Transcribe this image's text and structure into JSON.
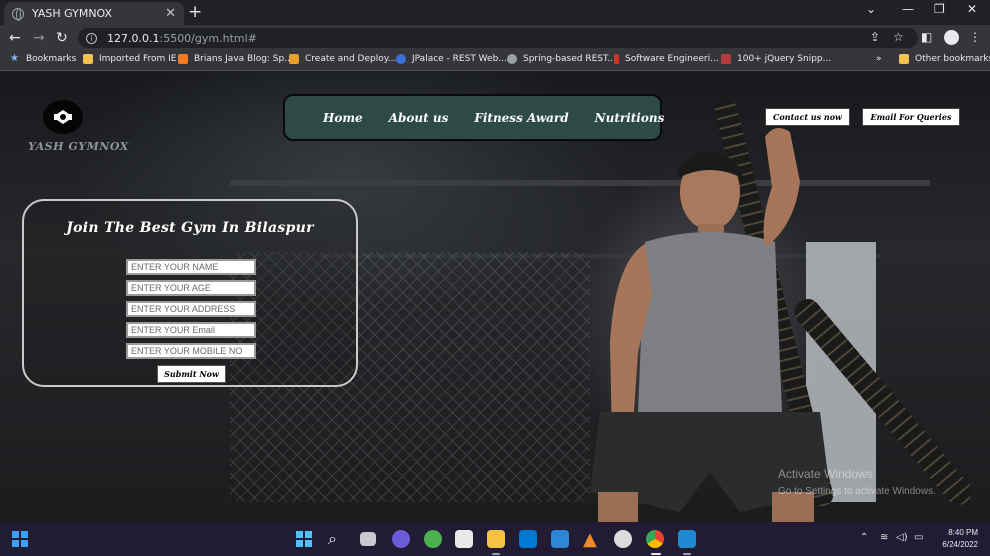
{
  "browser": {
    "tab_title": "YASH GYMNOX",
    "tab_close": "✕",
    "new_tab": "+",
    "url_host": "127.0.0.1",
    "url_path": ":5500/gym.html#",
    "bookmarks": [
      {
        "label": "Bookmarks",
        "color": "#8ab4f8"
      },
      {
        "label": "Imported From IE",
        "color": "#f2c14e"
      },
      {
        "label": "Brians Java Blog: Sp...",
        "color": "#f4791f"
      },
      {
        "label": "Create and Deploy...",
        "color": "#e79e2a"
      },
      {
        "label": "JPalace - REST Web...",
        "color": "#3b6fd8"
      },
      {
        "label": "Spring-based REST...",
        "color": "#9aa0a6"
      },
      {
        "label": "Software Engineeri...",
        "color": "#d93025"
      },
      {
        "label": "100+ jQuery Snipp...",
        "color": "#b33b3b"
      }
    ],
    "more_bookmarks": "»",
    "other_bookmarks": "Other bookmarks"
  },
  "site": {
    "logo_text": "YASH GYMNOX",
    "nav": [
      "Home",
      "About us",
      "Fitness Award",
      "Nutritions"
    ],
    "contact_button": "Contact us now",
    "email_button": "Email For Queries",
    "form": {
      "title": "Join The Best Gym In Bilaspur",
      "placeholders": {
        "name": "ENTER YOUR NAME",
        "age": "ENTER YOUR AGE",
        "address": "ENTER YOUR ADDRESS",
        "email": "ENTER YOUR Email",
        "mobile": "ENTER YOUR MOBILE NO"
      },
      "submit": "Submit Now"
    }
  },
  "watermark": {
    "line1": "Activate Windows",
    "line2": "Go to Settings to activate Windows."
  },
  "taskbar": {
    "time": "8:40 PM",
    "date": "6/24/2022"
  },
  "colors": {
    "nav_bg": "#2e4a46",
    "taskbar_bg": "#221b34",
    "chrome_dark": "#202124",
    "chrome_mid": "#35363a"
  }
}
